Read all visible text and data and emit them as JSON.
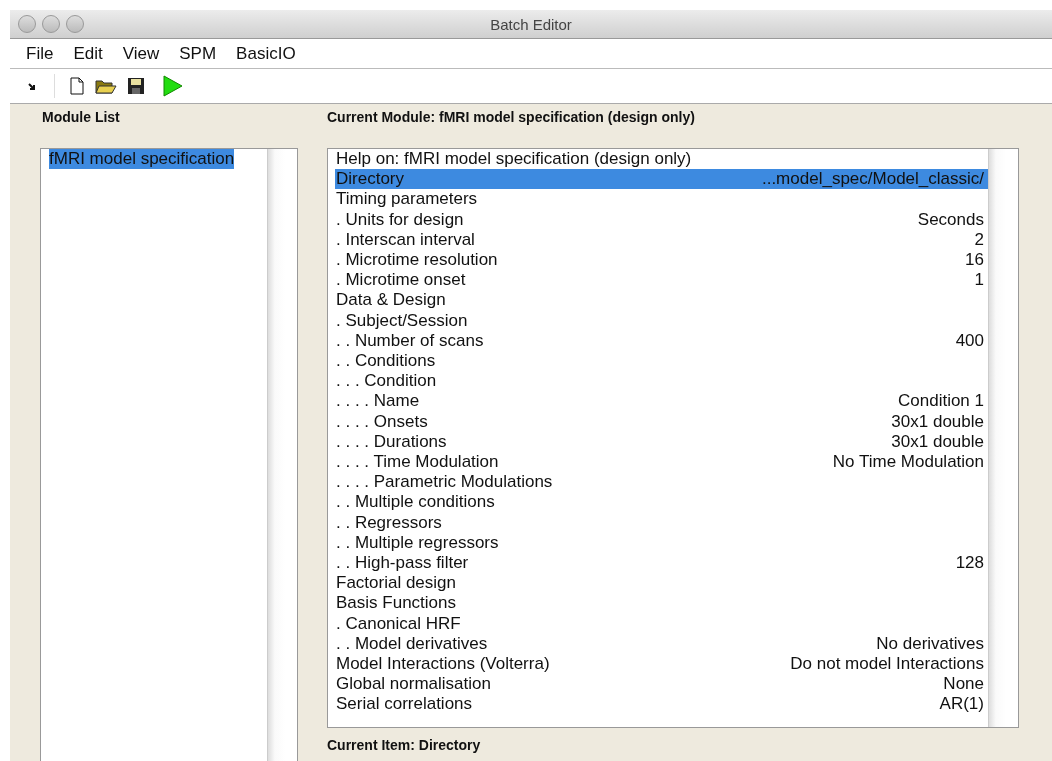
{
  "window": {
    "title": "Batch Editor"
  },
  "menu": [
    "File",
    "Edit",
    "View",
    "SPM",
    "BasicIO"
  ],
  "module_list": {
    "title": "Module List",
    "items": [
      {
        "label": "fMRI model specification",
        "selected": true
      }
    ]
  },
  "current_module": {
    "title": "Current Module: fMRI model specification (design only)",
    "items": [
      {
        "label": "Help on: fMRI model specification (design only)",
        "selected": false
      },
      {
        "label": "Directory",
        "value": "...model_spec/Model_classic/",
        "selected": true
      },
      {
        "label": "Timing parameters",
        "selected": false
      },
      {
        "label": ". Units for design",
        "value": "Seconds",
        "selected": false
      },
      {
        "label": ". Interscan interval",
        "value": "2",
        "selected": false
      },
      {
        "label": ". Microtime resolution",
        "value": "16",
        "selected": false
      },
      {
        "label": ". Microtime onset",
        "value": "1",
        "selected": false
      },
      {
        "label": "Data & Design",
        "selected": false
      },
      {
        "label": ". Subject/Session",
        "selected": false
      },
      {
        "label": ". . Number of scans",
        "value": "400",
        "selected": false
      },
      {
        "label": ". . Conditions",
        "selected": false
      },
      {
        "label": ". . . Condition",
        "selected": false
      },
      {
        "label": ". . . . Name",
        "value": "Condition 1",
        "selected": false
      },
      {
        "label": ". . . . Onsets",
        "value": "30x1 double",
        "selected": false
      },
      {
        "label": ". . . . Durations",
        "value": "30x1 double",
        "selected": false
      },
      {
        "label": ". . . . Time Modulation",
        "value": "No Time Modulation",
        "selected": false
      },
      {
        "label": ". . . . Parametric Modulations",
        "selected": false
      },
      {
        "label": ". . Multiple conditions",
        "selected": false
      },
      {
        "label": ". . Regressors",
        "selected": false
      },
      {
        "label": ". . Multiple regressors",
        "selected": false
      },
      {
        "label": ". . High-pass filter",
        "value": "128",
        "selected": false
      },
      {
        "label": "Factorial design",
        "selected": false
      },
      {
        "label": "Basis Functions",
        "selected": false
      },
      {
        "label": ". Canonical HRF",
        "selected": false
      },
      {
        "label": ". . Model derivatives",
        "value": "No derivatives",
        "selected": false
      },
      {
        "label": "Model Interactions (Volterra)",
        "value": "Do not model Interactions",
        "selected": false
      },
      {
        "label": "Global normalisation",
        "value": "None",
        "selected": false
      },
      {
        "label": "Serial correlations",
        "value": "AR(1)",
        "selected": false
      }
    ]
  },
  "current_item": {
    "title": "Current Item: Directory"
  }
}
